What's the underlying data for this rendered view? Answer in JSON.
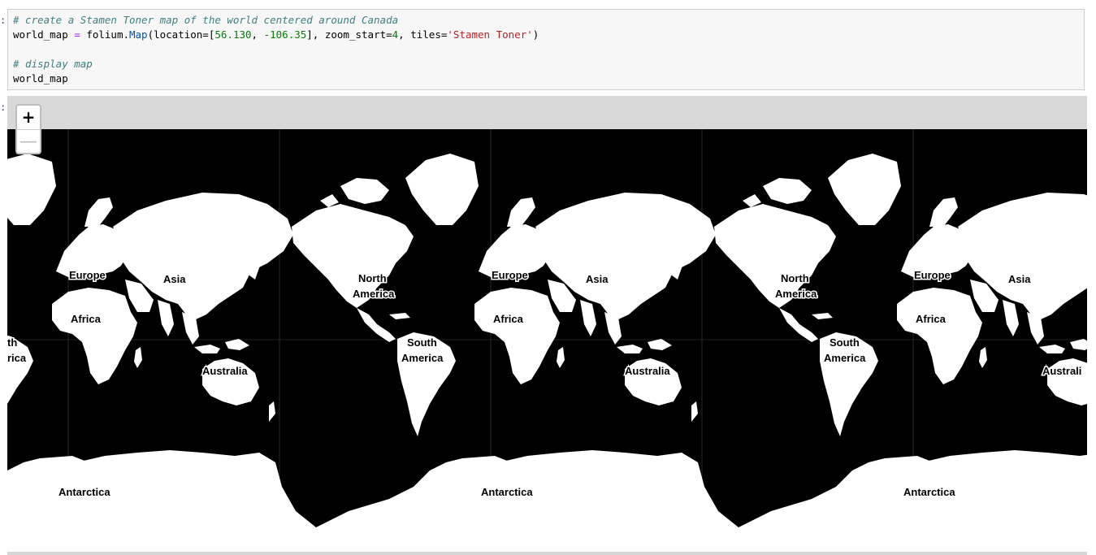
{
  "cell": {
    "line1": "# create a Stamen Toner map of the world centered around Canada",
    "line2_var": "world_map",
    "line2_eq": " = ",
    "line2_module": "folium",
    "line2_dot": ".",
    "line2_fn": "Map",
    "line2_open": "(location=[",
    "line2_lat": "56.130",
    "line2_comma": ", ",
    "line2_lon": "-106.35",
    "line2_mid": "], zoom_start=",
    "line2_zoom": "4",
    "line2_tilesarg": ", tiles=",
    "line2_tiles": "'Stamen Toner'",
    "line2_close": ")",
    "line4": "# display map",
    "line5": "world_map"
  },
  "map": {
    "zoom_in": "+",
    "zoom_out": "—",
    "labels": {
      "europe": "Europe",
      "asia": "Asia",
      "africa": "Africa",
      "north": "North",
      "america": "America",
      "south": "South",
      "australia": "Australia",
      "antarctica": "Antarctica",
      "partial_south": "th",
      "partial_america": "rica",
      "partial_australia": "Australi"
    },
    "colors": {
      "land": "#ffffff",
      "water": "#000000",
      "control_border": "#bfbfbf"
    }
  }
}
